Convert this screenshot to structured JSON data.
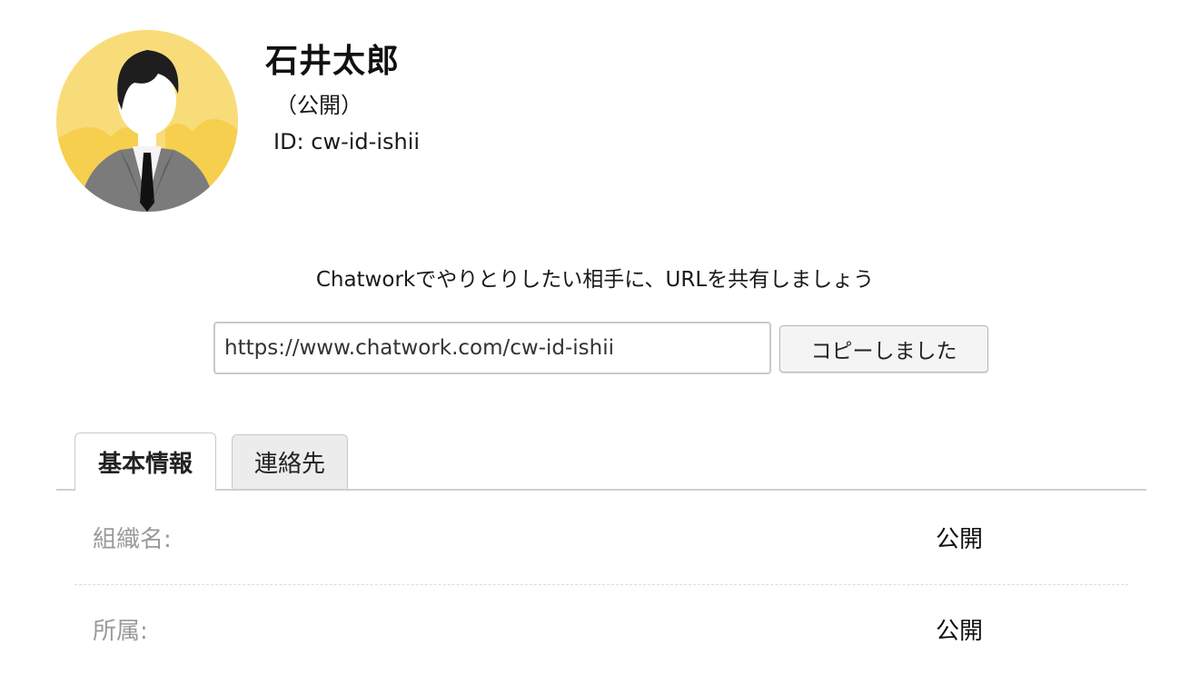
{
  "profile": {
    "name": "石井太郎",
    "visibility": "（公開）",
    "id_text": "ID: cw-id-ishii"
  },
  "share": {
    "message": "Chatworkでやりとりしたい相手に、URLを共有しましょう",
    "url": "https://www.chatwork.com/cw-id-ishii",
    "copy_button": "コピーしました"
  },
  "tabs": [
    {
      "label": "基本情報",
      "active": true
    },
    {
      "label": "連絡先",
      "active": false
    }
  ],
  "info_rows": [
    {
      "label": "組織名:",
      "value": "公開"
    },
    {
      "label": "所属:",
      "value": "公開"
    }
  ]
}
